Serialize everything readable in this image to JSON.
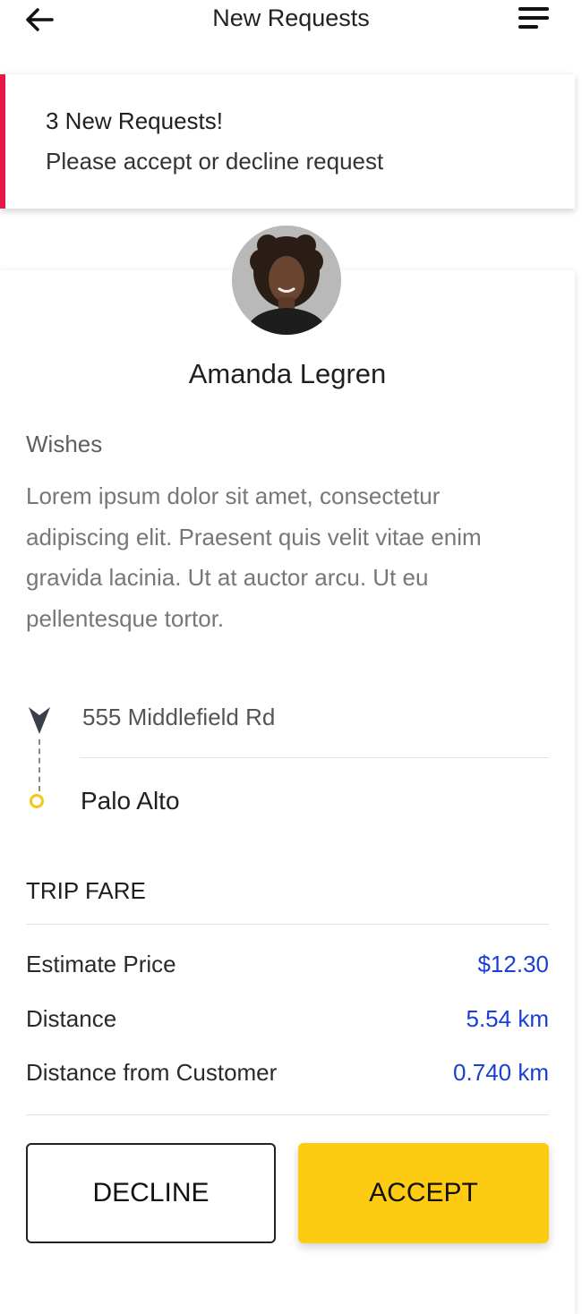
{
  "header": {
    "title": "New Requests",
    "back_icon": "arrow-left-icon",
    "menu_icon": "menu-icon"
  },
  "banner": {
    "title": "3 New Requests!",
    "subtitle": "Please accept or decline request",
    "accent_color": "#e8174a"
  },
  "customer": {
    "name": "Amanda Legren",
    "wishes_label": "Wishes",
    "wishes_text": "Lorem ipsum dolor sit amet, consectetur adipiscing elit. Praesent quis velit vitae enim gravida lacinia. Ut at auctor arcu. Ut eu pellentesque tortor."
  },
  "route": {
    "from": "555 Middlefield Rd",
    "to": "Palo Alto",
    "from_icon": "location-arrow-icon",
    "to_icon": "destination-circle-icon"
  },
  "fare": {
    "title": "TRIP FARE",
    "rows": [
      {
        "label": "Estimate Price",
        "value": "$12.30"
      },
      {
        "label": "Distance",
        "value": "5.54 km"
      },
      {
        "label": "Distance from Customer",
        "value": "0.740 km"
      }
    ],
    "value_color": "#1a3fd6"
  },
  "actions": {
    "decline_label": "DECLINE",
    "accept_label": "ACCEPT",
    "accept_color": "#fdcc12"
  }
}
